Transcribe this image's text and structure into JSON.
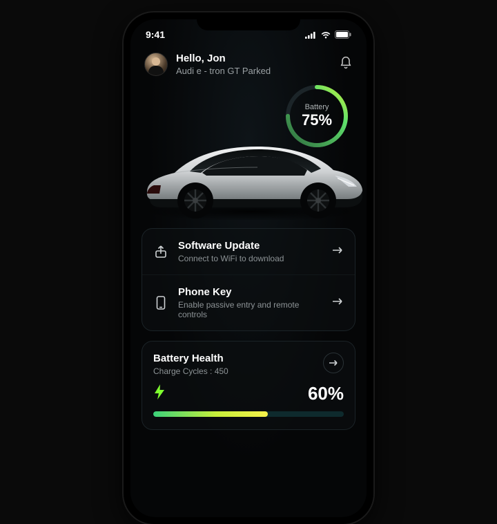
{
  "status": {
    "time": "9:41"
  },
  "header": {
    "greeting": "Hello, Jon",
    "vehicle_status": "Audi e - tron GT Parked"
  },
  "battery_ring": {
    "label": "Battery",
    "percent_text": "75%",
    "percent_value": 75
  },
  "cards": [
    {
      "icon": "upload-icon",
      "title": "Software Update",
      "subtitle": "Connect to WiFi to download"
    },
    {
      "icon": "phone-icon",
      "title": "Phone Key",
      "subtitle": "Enable passive entry and remote controls"
    }
  ],
  "battery_health": {
    "title": "Battery Health",
    "cycles_label": "Charge Cycles : 450",
    "percent_text": "60%",
    "percent_value": 60
  },
  "colors": {
    "accent_green": "#3bd17a",
    "accent_lime": "#c6ef3a"
  }
}
